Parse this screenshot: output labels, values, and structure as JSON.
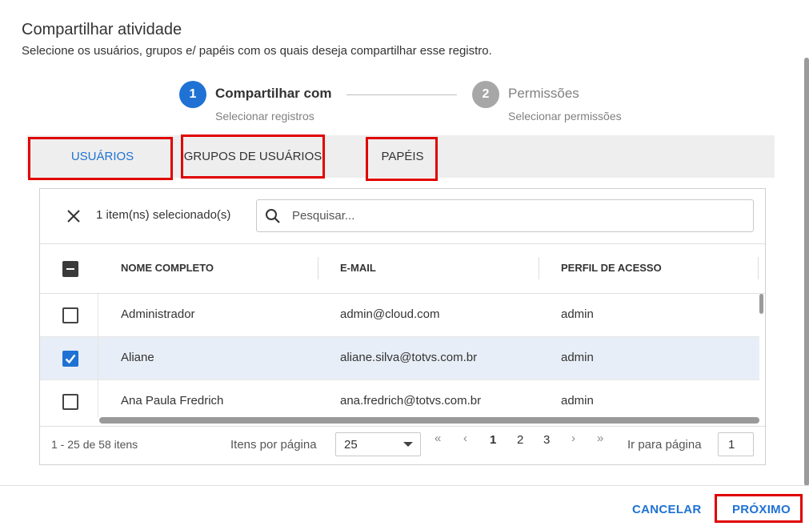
{
  "dialog": {
    "title": "Compartilhar atividade",
    "subtitle": "Selecione os usuários, grupos e/ papéis com os quais deseja compartilhar esse registro."
  },
  "stepper": [
    {
      "number": "1",
      "label": "Compartilhar com",
      "sublabel": "Selecionar registros",
      "state": "active",
      "color": "#1f72d3"
    },
    {
      "number": "2",
      "label": "Permissões",
      "sublabel": "Selecionar permissões",
      "state": "inactive",
      "color": "#a7a7a7"
    }
  ],
  "tabs": [
    {
      "label": "USUÁRIOS",
      "active": true
    },
    {
      "label": "GRUPOS DE USUÁRIOS",
      "active": false
    },
    {
      "label": "PAPÉIS",
      "active": false
    }
  ],
  "toolbar": {
    "clear_icon": "close-icon",
    "selected_count": "1 item(ns) selecionado(s)",
    "search_placeholder": "Pesquisar...",
    "search_value": ""
  },
  "table": {
    "columns": [
      "NOME COMPLETO",
      "E-MAIL",
      "PERFIL DE ACESSO"
    ],
    "header_checkbox": "indeterminate",
    "rows": [
      {
        "name": "Administrador",
        "email": "admin@cloud.com",
        "profile": "admin",
        "checked": false
      },
      {
        "name": "Aliane",
        "email": "aliane.silva@totvs.com.br",
        "profile": "admin",
        "checked": true
      },
      {
        "name": "Ana Paula Fredrich",
        "email": "ana.fredrich@totvs.com.br",
        "profile": "admin",
        "checked": false
      }
    ]
  },
  "pagination": {
    "range": "1 - 25 de 58 itens",
    "items_per_page_label": "Itens por página",
    "items_per_page_value": "25",
    "first": "«",
    "prev": "‹",
    "pages": [
      "1",
      "2",
      "3"
    ],
    "current_page": "1",
    "next": "›",
    "last": "»",
    "goto_label": "Ir para página",
    "goto_value": "1"
  },
  "footer": {
    "cancel": "CANCELAR",
    "next": "PRÓXIMO"
  },
  "colors": {
    "accent": "#1f72d3",
    "highlight": "#e00000",
    "selected_row": "#e8eef7"
  }
}
